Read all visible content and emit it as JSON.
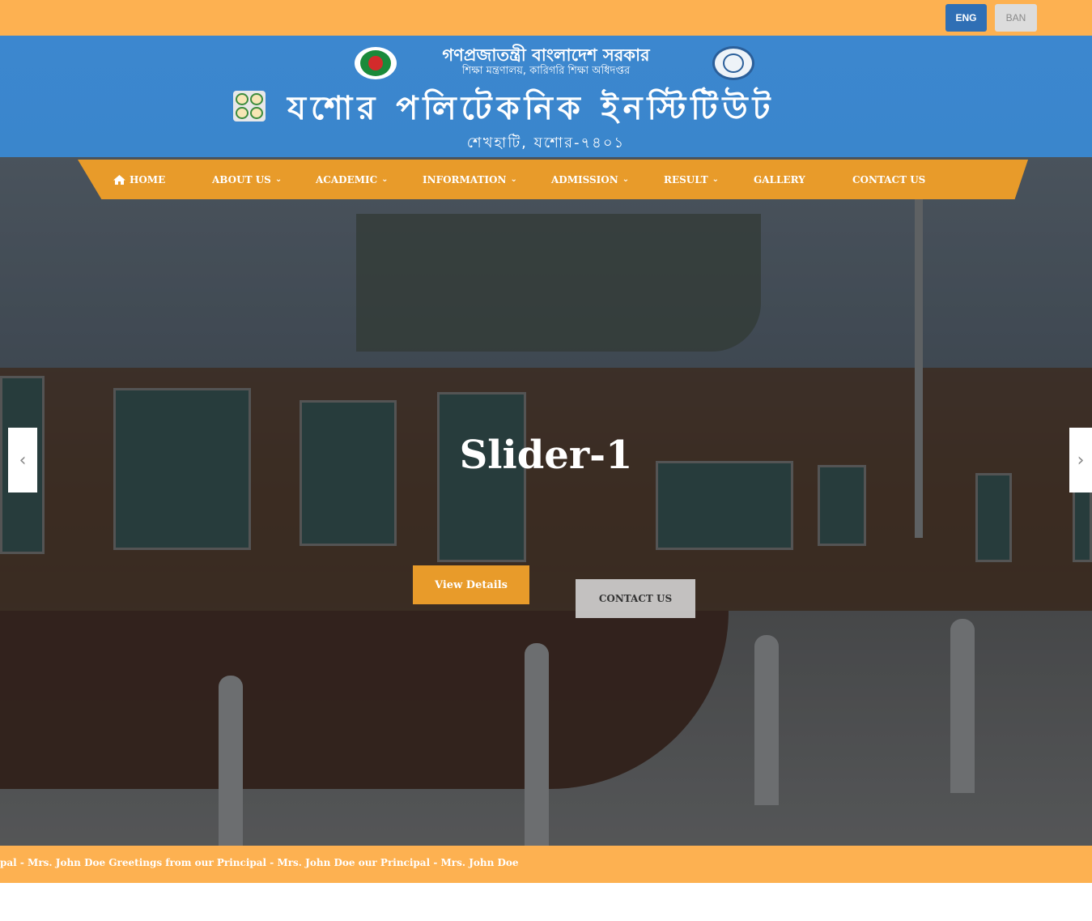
{
  "topbar": {
    "lang_eng": "ENG",
    "lang_ban": "BAN"
  },
  "header": {
    "gov_title": "গণপ্রজাতন্ত্রী বাংলাদেশ সরকার",
    "gov_subtitle": "শিক্ষা মন্ত্রণালয়, কারিগরি শিক্ষা অধিদপ্তর",
    "institute_name": "যশোর পলিটেকনিক ইনস্টিটিউট",
    "address": "শেখহাটি, যশোর-৭৪০১"
  },
  "nav": {
    "items": [
      {
        "label": "HOME",
        "has_dropdown": false,
        "icon": "home-icon"
      },
      {
        "label": "ABOUT US",
        "has_dropdown": true
      },
      {
        "label": "ACADEMIC",
        "has_dropdown": true
      },
      {
        "label": "INFORMATION",
        "has_dropdown": true
      },
      {
        "label": "ADMISSION",
        "has_dropdown": true
      },
      {
        "label": "RESULT",
        "has_dropdown": true
      },
      {
        "label": "GALLERY",
        "has_dropdown": false
      },
      {
        "label": "CONTACT US",
        "has_dropdown": false
      }
    ],
    "dropdown_glyph": "⌄"
  },
  "slider": {
    "title": "Slider-1",
    "view_details_label": "View Details",
    "contact_label": "CONTACT US",
    "prev_glyph": "‹",
    "next_glyph": "›"
  },
  "ticker": {
    "text": "pal - Mrs. John Doe   Greetings from our Principal - Mrs. John Doe   our Principal - Mrs. John Doe"
  },
  "colors": {
    "accent_orange": "#fdb151",
    "nav_orange": "#e89b2a",
    "header_blue": "#3a86cc",
    "eng_button": "#2f6fb5"
  }
}
